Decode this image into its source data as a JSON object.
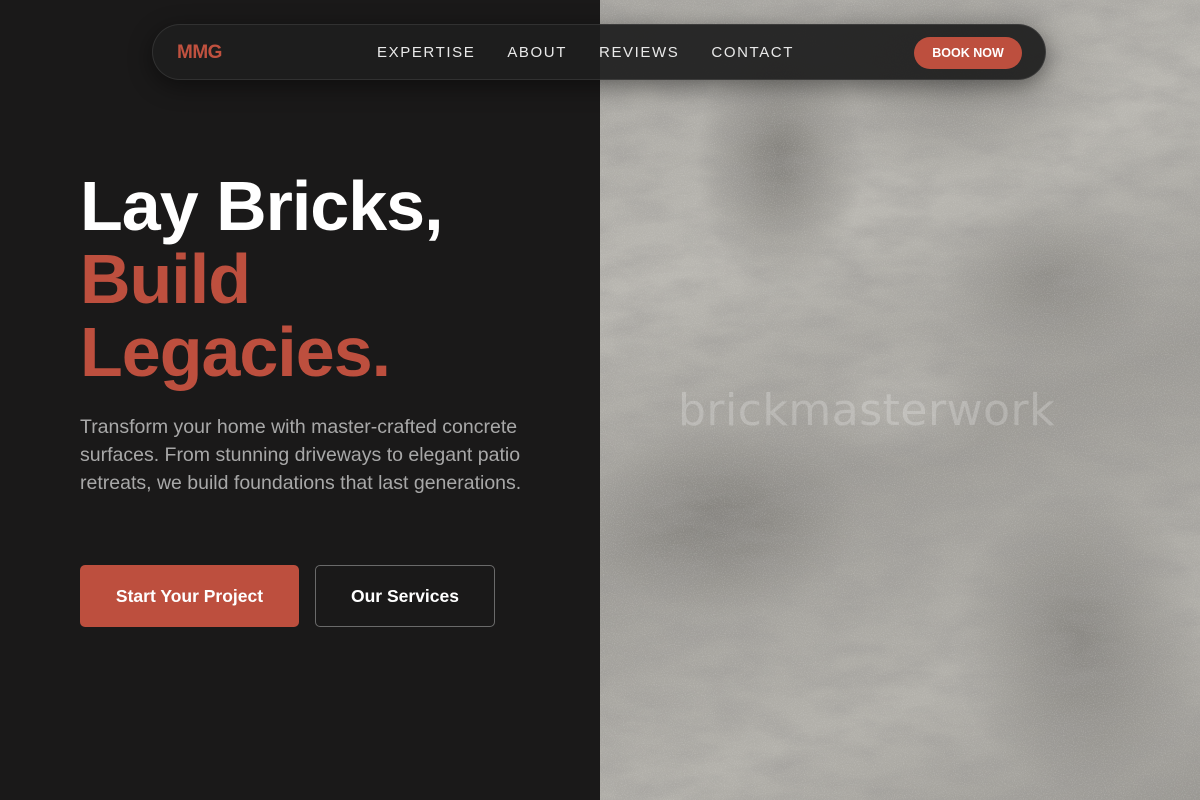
{
  "brand": {
    "logo_text": "MMG",
    "accent_color": "#bd4f3e"
  },
  "nav": {
    "links": [
      {
        "label": "EXPERTISE"
      },
      {
        "label": "ABOUT"
      },
      {
        "label": "REVIEWS"
      },
      {
        "label": "CONTACT"
      }
    ],
    "cta_label": "BOOK NOW"
  },
  "hero": {
    "title_line1": "Lay Bricks,",
    "title_line2": "Build",
    "title_line3": "Legacies.",
    "description": "Transform your home with master-crafted concrete surfaces. From stunning driveways to elegant patio retreats, we build foundations that last generations.",
    "primary_button": "Start Your Project",
    "secondary_button": "Our Services"
  },
  "image_panel": {
    "watermark": "brickmasterwork"
  }
}
